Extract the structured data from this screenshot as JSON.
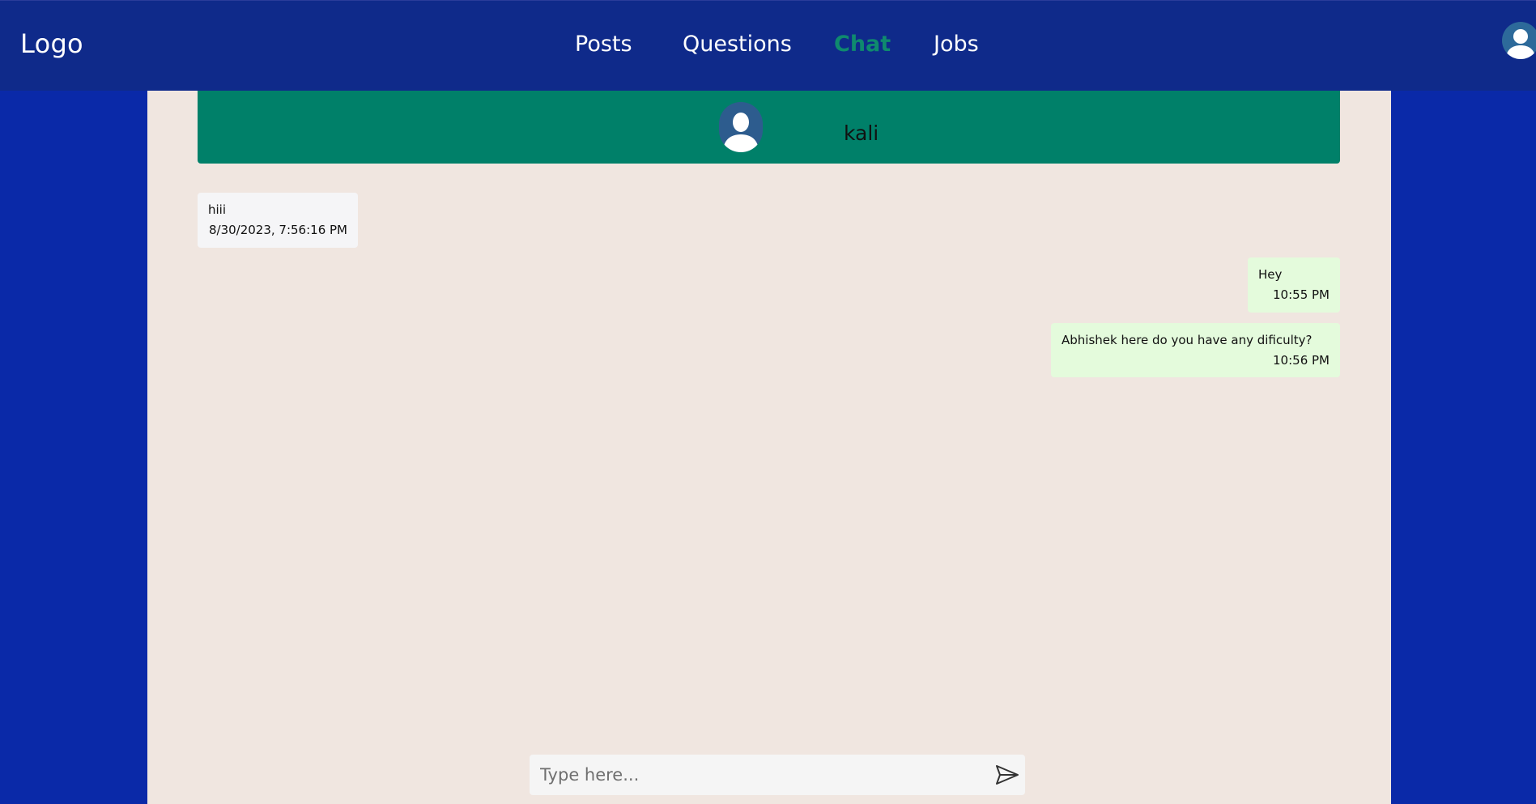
{
  "navbar": {
    "logo": "Logo",
    "links": [
      {
        "label": "Posts"
      },
      {
        "label": "Questions"
      },
      {
        "label": "Chat",
        "active": true
      },
      {
        "label": "Jobs"
      }
    ],
    "profile_icon": "user-avatar-icon"
  },
  "chat": {
    "contact_name": "kali",
    "contact_avatar_icon": "user-avatar-icon",
    "messages": [
      {
        "direction": "incoming",
        "text": "hiii",
        "time": "8/30/2023, 7:56:16 PM"
      },
      {
        "direction": "outgoing",
        "text": "Hey",
        "time": "10:55 PM"
      },
      {
        "direction": "outgoing",
        "text": "Abhishek here do you have any dificulty?",
        "time": "10:56 PM"
      }
    ]
  },
  "composer": {
    "placeholder": "Type here...",
    "value": "",
    "send_icon": "send-icon"
  },
  "colors": {
    "page_background": "#0a29a8",
    "navbar_background": "#0f2a8a",
    "active_link": "#0f8a6e",
    "chat_header": "#008069",
    "chat_background": "#f0e6e0",
    "incoming_bubble": "#f5f5f7",
    "outgoing_bubble": "#e4fbdc"
  }
}
